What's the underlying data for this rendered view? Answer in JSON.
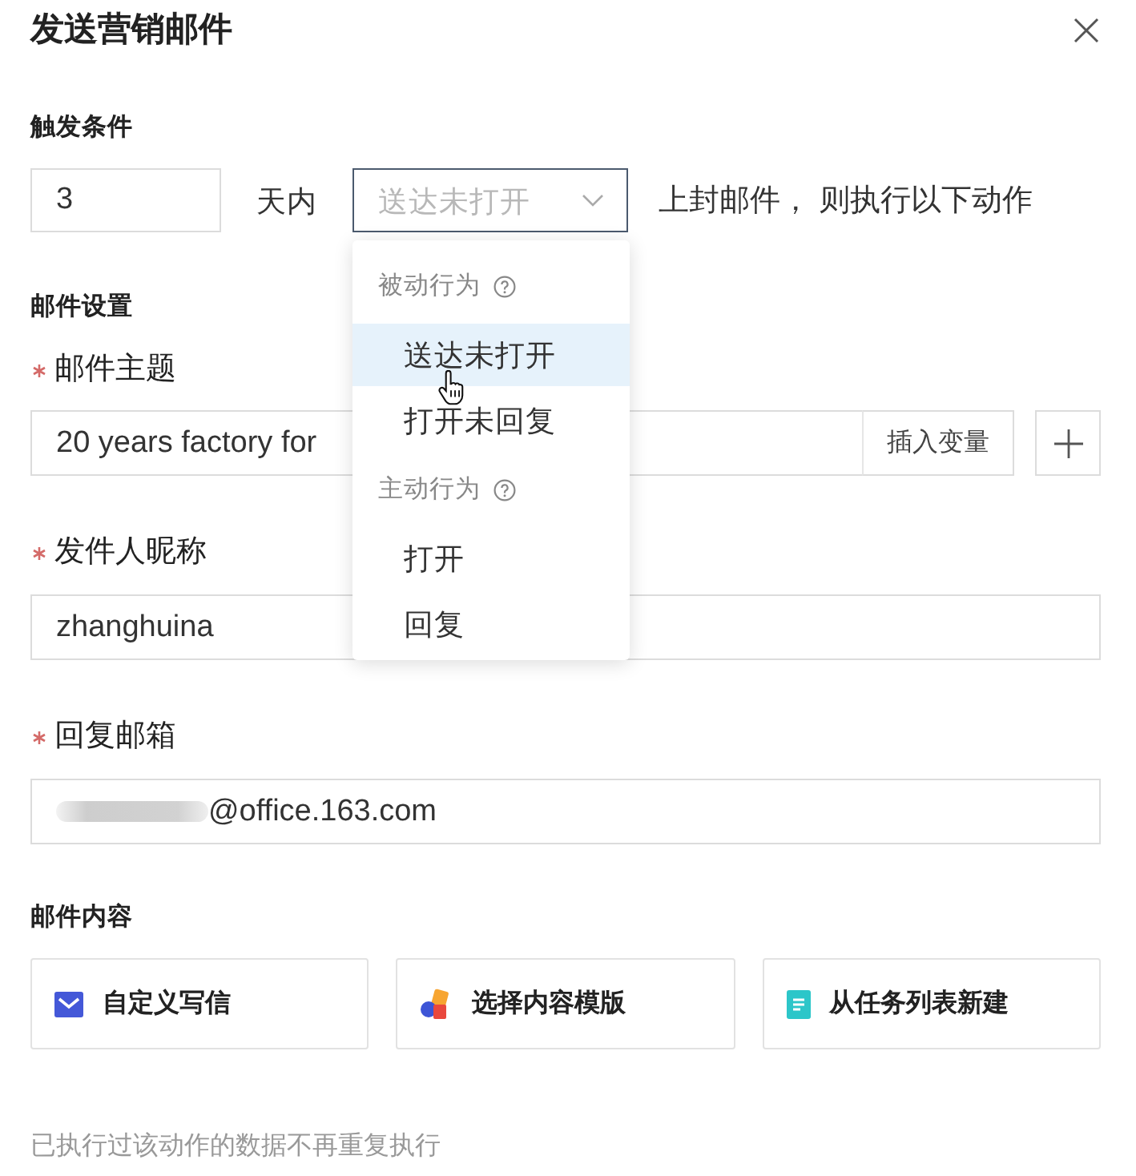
{
  "dialog": {
    "title": "发送营销邮件"
  },
  "trigger": {
    "heading": "触发条件",
    "days_input": {
      "value": "3"
    },
    "days_suffix": "天内",
    "select": {
      "placeholder": "送达未打开",
      "expanded": true
    },
    "suffix": "上封邮件， 则执行以下动作"
  },
  "dropdown": {
    "groups": [
      {
        "label": "被动行为",
        "items": [
          {
            "label": "送达未打开",
            "selected": true
          },
          {
            "label": "打开未回复",
            "selected": false
          }
        ]
      },
      {
        "label": "主动行为",
        "items": [
          {
            "label": "打开",
            "selected": false
          },
          {
            "label": "回复",
            "selected": false
          }
        ]
      }
    ]
  },
  "mail_settings": {
    "heading": "邮件设置",
    "fields": [
      {
        "label": "邮件主题",
        "required": true,
        "kind": "subject",
        "value": "20 years factory for",
        "masked": false,
        "addon": "插入变量"
      },
      {
        "label": "发件人昵称",
        "required": true,
        "kind": "text",
        "value": "zhanghuina",
        "masked": false
      },
      {
        "label": "回复邮箱",
        "required": true,
        "kind": "text",
        "value": "@office.163.com",
        "masked": true
      }
    ]
  },
  "content": {
    "heading": "邮件内容",
    "options": [
      {
        "label": "自定义写信",
        "kind": "compose"
      },
      {
        "label": "选择内容模版",
        "kind": "template"
      },
      {
        "label": "从任务列表新建",
        "kind": "task"
      }
    ]
  },
  "footer_note": "已执行过该动作的数据不再重复执行"
}
